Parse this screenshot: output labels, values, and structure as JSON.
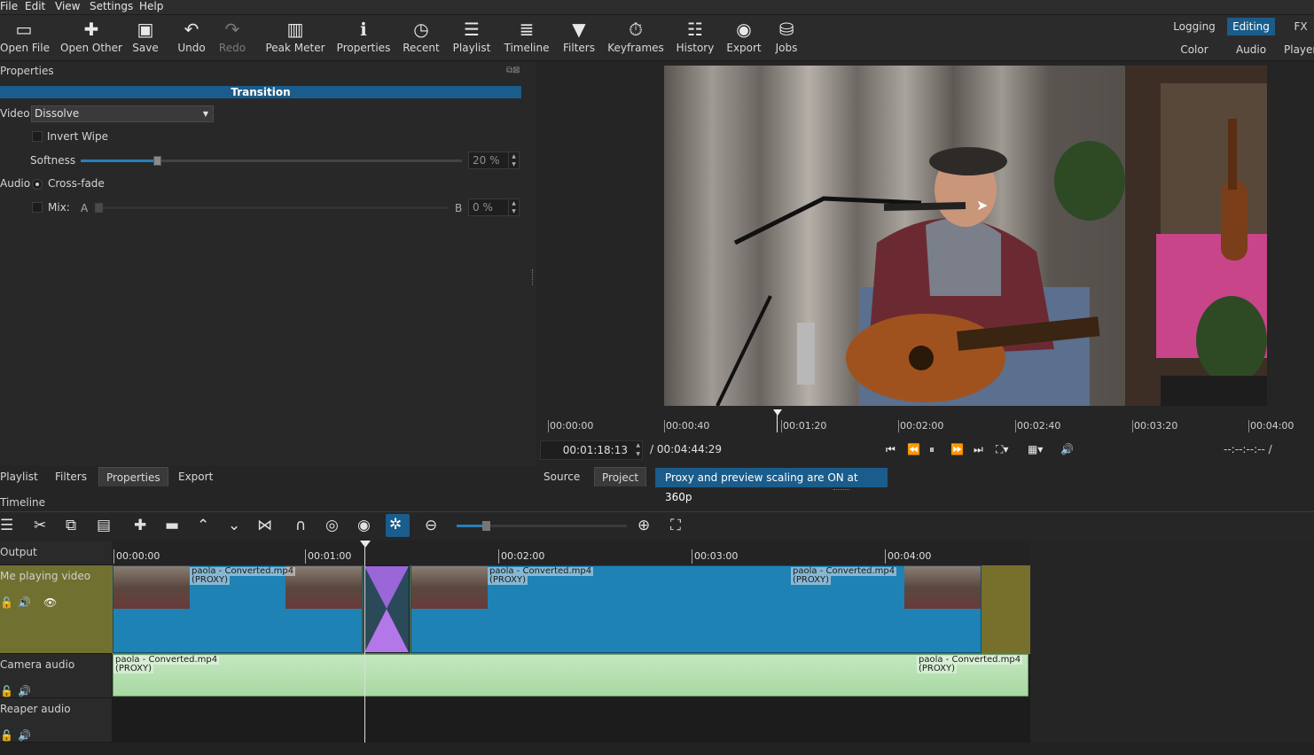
{
  "menu": [
    "File",
    "Edit",
    "View",
    "Settings",
    "Help"
  ],
  "toolbar": {
    "open_file": "Open File",
    "open_other": "Open Other",
    "save": "Save",
    "undo": "Undo",
    "redo": "Redo",
    "peak_meter": "Peak Meter",
    "properties": "Properties",
    "recent": "Recent",
    "playlist": "Playlist",
    "timeline": "Timeline",
    "filters": "Filters",
    "keyframes": "Keyframes",
    "history": "History",
    "export": "Export",
    "jobs": "Jobs"
  },
  "workspaces": {
    "logging": "Logging",
    "editing": "Editing",
    "fx": "FX",
    "color": "Color",
    "audio": "Audio",
    "player": "Player"
  },
  "properties_panel": {
    "title": "Properties",
    "section": "Transition",
    "video_label": "Video",
    "video_value": "Dissolve",
    "invert_wipe": "Invert Wipe",
    "softness_label": "Softness",
    "softness_value": "20 %",
    "softness_fraction": 0.2,
    "audio_label": "Audio",
    "crossfade": "Cross-fade",
    "mix_label": "Mix:",
    "mix_a": "A",
    "mix_b": "B",
    "mix_value": "0 %"
  },
  "player": {
    "ruler": [
      "00:00:00",
      "00:00:40",
      "00:01:20",
      "00:02:00",
      "00:02:40",
      "00:03:20",
      "00:04:00"
    ],
    "current_time": "00:01:18:13",
    "total_time": "/ 00:04:44:29",
    "in_out": "--:--:--:-- /",
    "tab_source": "Source",
    "tab_project": "Project",
    "proxy_notice": "Proxy and preview scaling are ON at 360p"
  },
  "bottom_tabs": [
    "Playlist",
    "Filters",
    "Properties",
    "Export"
  ],
  "timeline": {
    "title": "Timeline",
    "ruler": [
      "00:00:00",
      "00:01:00",
      "00:02:00",
      "00:03:00",
      "00:04:00"
    ],
    "output": "Output",
    "tracks": [
      {
        "name": "Me playing video"
      },
      {
        "name": "Camera audio"
      },
      {
        "name": "Reaper audio"
      }
    ],
    "clip_name": "paola - Converted.mp4",
    "proxy_tag": "(PROXY)"
  },
  "colors": {
    "accent": "#1a5c8b",
    "clip": "#1f82b5",
    "audio_clip": "#b6e0b0",
    "track_bg": "#77702c"
  }
}
